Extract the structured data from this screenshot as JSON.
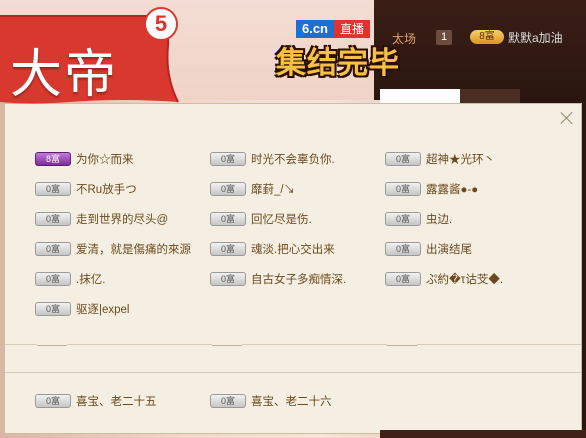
{
  "stream": {
    "host_label": "太场",
    "room_num": "1",
    "user_level": "8富",
    "user_name": "默默a加油",
    "site_logo": "6.cn",
    "live_tag": "直播",
    "overlay_text": "集结完毕"
  },
  "badge": {
    "title": "大帝",
    "count": "5",
    "color": "#d9382e"
  },
  "panel": {
    "close_icon": "close-icon",
    "members": [
      [
        {
          "level": "8富",
          "name": "为你☆而来",
          "highlight": true
        },
        {
          "level": "0富",
          "name": "时光不会辜负你.",
          "highlight": false
        },
        {
          "level": "0富",
          "name": "超神★光环丶",
          "highlight": false
        }
      ],
      [
        {
          "level": "0富",
          "name": "不Ru放手つ",
          "highlight": false
        },
        {
          "level": "0富",
          "name": "靡葑_/↘",
          "highlight": false
        },
        {
          "level": "0富",
          "name": "露露酱●-●",
          "highlight": false
        }
      ],
      [
        {
          "level": "0富",
          "name": "走到世界的尽头@",
          "highlight": false
        },
        {
          "level": "0富",
          "name": "回忆尽是伤.",
          "highlight": false
        },
        {
          "level": "0富",
          "name": "虫边.",
          "highlight": false
        }
      ],
      [
        {
          "level": "0富",
          "name": "爱清，就是傷痛的來源",
          "highlight": false
        },
        {
          "level": "0富",
          "name": "魂淡.把心交出来",
          "highlight": false
        },
        {
          "level": "0富",
          "name": "出演结尾",
          "highlight": false
        }
      ],
      [
        {
          "level": "0富",
          "name": ".抹亿.",
          "highlight": false
        },
        {
          "level": "0富",
          "name": "自古女子多痴情深.",
          "highlight": false
        },
        {
          "level": "0富",
          "name": "ぷ約�τ诂芠◆.",
          "highlight": false
        }
      ],
      [
        {
          "level": "0富",
          "name": "驱逐|expel",
          "highlight": false
        }
      ]
    ],
    "members2": [
      {
        "level": "0富",
        "name": "喜宝、老二十五"
      },
      {
        "level": "0富",
        "name": "喜宝、老二十六"
      }
    ]
  }
}
